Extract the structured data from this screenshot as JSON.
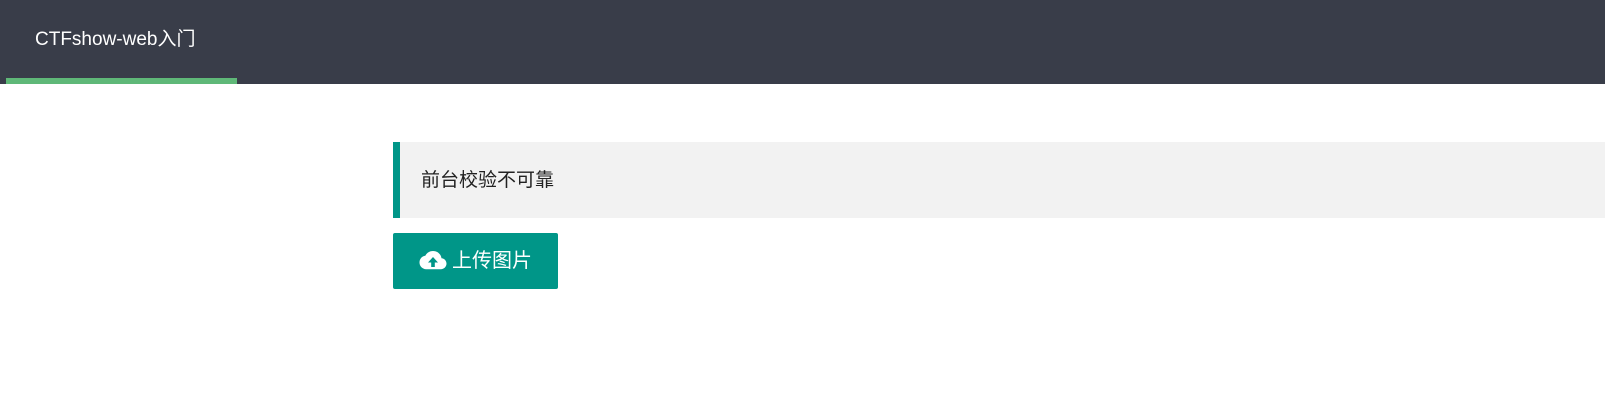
{
  "header": {
    "nav_items": [
      {
        "label": "CTFshow-web入门",
        "active": true
      }
    ],
    "background_color": "#393D49",
    "active_indicator_color": "#5FB878"
  },
  "main": {
    "notice": {
      "text": "前台校验不可靠",
      "accent_color": "#009688"
    },
    "upload_button": {
      "label": "上传图片",
      "icon": "cloud-upload-icon",
      "color": "#009688"
    }
  }
}
